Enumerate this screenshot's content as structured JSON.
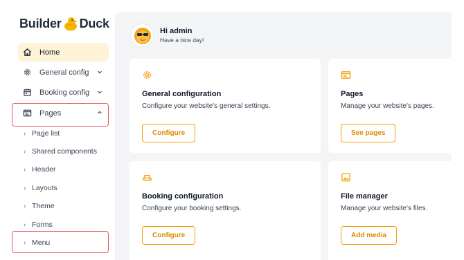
{
  "brand": {
    "name_part1": "Builder",
    "name_part2": "Duck",
    "accent_color": "#f59e0b"
  },
  "sidebar": {
    "collapse_symbol": "‹",
    "items": [
      {
        "label": "Home",
        "icon": "home-icon",
        "active": true
      },
      {
        "label": "General config",
        "icon": "gear-icon",
        "expandable": true,
        "expanded": false
      },
      {
        "label": "Booking config",
        "icon": "calendar-icon",
        "expandable": true,
        "expanded": false
      },
      {
        "label": "Pages",
        "icon": "pages-icon",
        "expandable": true,
        "expanded": true
      }
    ],
    "sub_items": [
      "Page list",
      "Shared components",
      "Header",
      "Layouts",
      "Theme",
      "Forms",
      "Menu"
    ],
    "sub_arrow": "›"
  },
  "header": {
    "greeting": "Hi admin",
    "subtitle": "Have a nice day!"
  },
  "cards": [
    {
      "title": "General configuration",
      "description": "Configure your website's general settings.",
      "button": "Configure",
      "icon": "gear-icon"
    },
    {
      "title": "Pages",
      "description": "Manage your website's pages.",
      "button": "See pages",
      "icon": "pages-icon"
    },
    {
      "title": "Booking configuration",
      "description": "Configure your booking settings.",
      "button": "Configure",
      "icon": "car-icon"
    },
    {
      "title": "File manager",
      "description": "Manage your website's files.",
      "button": "Add media",
      "icon": "image-icon"
    }
  ],
  "highlight_color": "#e8545e"
}
